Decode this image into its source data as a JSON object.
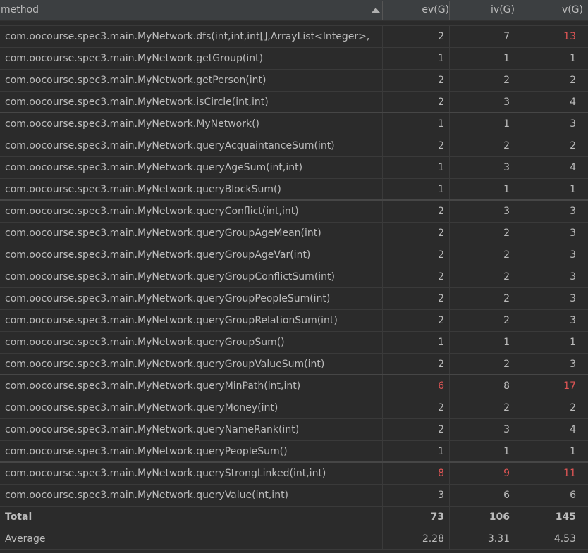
{
  "header": {
    "method": "method",
    "ev": "ev(G)",
    "iv": "iv(G)",
    "v": "v(G)"
  },
  "rows": [
    {
      "method": "com.oocourse.spec3.main.MyNetwork.dfs(int,int,int[],ArrayList<Integer>,",
      "ev": "2",
      "iv": "7",
      "v": "13",
      "ev_red": false,
      "iv_red": false,
      "v_red": true
    },
    {
      "method": "com.oocourse.spec3.main.MyNetwork.getGroup(int)",
      "ev": "1",
      "iv": "1",
      "v": "1",
      "ev_red": false,
      "iv_red": false,
      "v_red": false
    },
    {
      "method": "com.oocourse.spec3.main.MyNetwork.getPerson(int)",
      "ev": "2",
      "iv": "2",
      "v": "2",
      "ev_red": false,
      "iv_red": false,
      "v_red": false
    },
    {
      "method": "com.oocourse.spec3.main.MyNetwork.isCircle(int,int)",
      "ev": "2",
      "iv": "3",
      "v": "4",
      "ev_red": false,
      "iv_red": false,
      "v_red": false
    },
    {
      "method": "com.oocourse.spec3.main.MyNetwork.MyNetwork()",
      "ev": "1",
      "iv": "1",
      "v": "3",
      "ev_red": false,
      "iv_red": false,
      "v_red": false
    },
    {
      "method": "com.oocourse.spec3.main.MyNetwork.queryAcquaintanceSum(int)",
      "ev": "2",
      "iv": "2",
      "v": "2",
      "ev_red": false,
      "iv_red": false,
      "v_red": false
    },
    {
      "method": "com.oocourse.spec3.main.MyNetwork.queryAgeSum(int,int)",
      "ev": "1",
      "iv": "3",
      "v": "4",
      "ev_red": false,
      "iv_red": false,
      "v_red": false
    },
    {
      "method": "com.oocourse.spec3.main.MyNetwork.queryBlockSum()",
      "ev": "1",
      "iv": "1",
      "v": "1",
      "ev_red": false,
      "iv_red": false,
      "v_red": false
    },
    {
      "method": "com.oocourse.spec3.main.MyNetwork.queryConflict(int,int)",
      "ev": "2",
      "iv": "3",
      "v": "3",
      "ev_red": false,
      "iv_red": false,
      "v_red": false
    },
    {
      "method": "com.oocourse.spec3.main.MyNetwork.queryGroupAgeMean(int)",
      "ev": "2",
      "iv": "2",
      "v": "3",
      "ev_red": false,
      "iv_red": false,
      "v_red": false
    },
    {
      "method": "com.oocourse.spec3.main.MyNetwork.queryGroupAgeVar(int)",
      "ev": "2",
      "iv": "2",
      "v": "3",
      "ev_red": false,
      "iv_red": false,
      "v_red": false
    },
    {
      "method": "com.oocourse.spec3.main.MyNetwork.queryGroupConflictSum(int)",
      "ev": "2",
      "iv": "2",
      "v": "3",
      "ev_red": false,
      "iv_red": false,
      "v_red": false
    },
    {
      "method": "com.oocourse.spec3.main.MyNetwork.queryGroupPeopleSum(int)",
      "ev": "2",
      "iv": "2",
      "v": "3",
      "ev_red": false,
      "iv_red": false,
      "v_red": false
    },
    {
      "method": "com.oocourse.spec3.main.MyNetwork.queryGroupRelationSum(int)",
      "ev": "2",
      "iv": "2",
      "v": "3",
      "ev_red": false,
      "iv_red": false,
      "v_red": false
    },
    {
      "method": "com.oocourse.spec3.main.MyNetwork.queryGroupSum()",
      "ev": "1",
      "iv": "1",
      "v": "1",
      "ev_red": false,
      "iv_red": false,
      "v_red": false
    },
    {
      "method": "com.oocourse.spec3.main.MyNetwork.queryGroupValueSum(int)",
      "ev": "2",
      "iv": "2",
      "v": "3",
      "ev_red": false,
      "iv_red": false,
      "v_red": false
    },
    {
      "method": "com.oocourse.spec3.main.MyNetwork.queryMinPath(int,int)",
      "ev": "6",
      "iv": "8",
      "v": "17",
      "ev_red": true,
      "iv_red": false,
      "v_red": true
    },
    {
      "method": "com.oocourse.spec3.main.MyNetwork.queryMoney(int)",
      "ev": "2",
      "iv": "2",
      "v": "2",
      "ev_red": false,
      "iv_red": false,
      "v_red": false
    },
    {
      "method": "com.oocourse.spec3.main.MyNetwork.queryNameRank(int)",
      "ev": "2",
      "iv": "3",
      "v": "4",
      "ev_red": false,
      "iv_red": false,
      "v_red": false
    },
    {
      "method": "com.oocourse.spec3.main.MyNetwork.queryPeopleSum()",
      "ev": "1",
      "iv": "1",
      "v": "1",
      "ev_red": false,
      "iv_red": false,
      "v_red": false
    },
    {
      "method": "com.oocourse.spec3.main.MyNetwork.queryStrongLinked(int,int)",
      "ev": "8",
      "iv": "9",
      "v": "11",
      "ev_red": true,
      "iv_red": true,
      "v_red": true
    },
    {
      "method": "com.oocourse.spec3.main.MyNetwork.queryValue(int,int)",
      "ev": "3",
      "iv": "6",
      "v": "6",
      "ev_red": false,
      "iv_red": false,
      "v_red": false
    }
  ],
  "total": {
    "label": "Total",
    "ev": "73",
    "iv": "106",
    "v": "145"
  },
  "average": {
    "label": "Average",
    "ev": "2.28",
    "iv": "3.31",
    "v": "4.53"
  },
  "colors": {
    "background": "#2b2b2b",
    "header": "#3c3f41",
    "text": "#bbbbbb",
    "warning": "#e05555"
  },
  "icons": {
    "sort": "sort-ascending-icon"
  }
}
